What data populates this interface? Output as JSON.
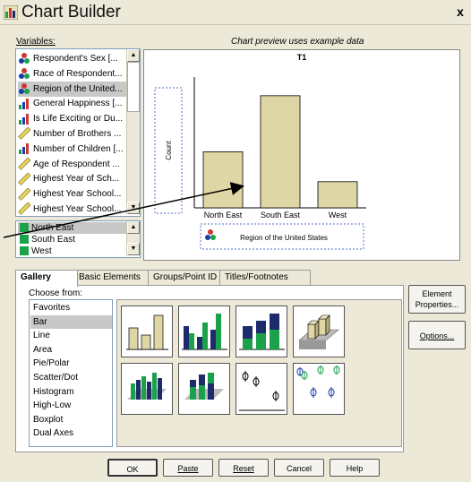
{
  "window": {
    "title": "Chart Builder",
    "close_glyph": "x"
  },
  "variables": {
    "label": "Variables:",
    "items": [
      {
        "label": "Respondent's Sex [...",
        "icon": "nominal-icon"
      },
      {
        "label": "Race of Respondent...",
        "icon": "nominal-icon"
      },
      {
        "label": "Region of the United...",
        "icon": "nominal-icon",
        "selected": true
      },
      {
        "label": "General Happiness [...",
        "icon": "ordinal-icon"
      },
      {
        "label": "Is Life Exciting or Du...",
        "icon": "ordinal-icon"
      },
      {
        "label": "Number of Brothers ...",
        "icon": "scale-icon"
      },
      {
        "label": "Number of Children [...",
        "icon": "ordinal-icon"
      },
      {
        "label": "Age of Respondent ...",
        "icon": "scale-icon"
      },
      {
        "label": "Highest Year of Sch...",
        "icon": "scale-icon"
      },
      {
        "label": "Highest Year School...",
        "icon": "scale-icon"
      },
      {
        "label": "Highest Year School...",
        "icon": "scale-icon"
      },
      {
        "label": "Highest Year School...",
        "icon": "scale-icon"
      }
    ]
  },
  "categories_list": {
    "items": [
      "North East",
      "South East",
      "West"
    ]
  },
  "preview": {
    "note": "Chart preview uses example data",
    "chart_data": {
      "type": "bar",
      "title": "T1",
      "categories": [
        "North East",
        "South East",
        "West"
      ],
      "values": [
        3,
        6,
        1.4
      ],
      "ylabel": "Count",
      "xlabel": "Region of the United States",
      "ylim": [
        0,
        7
      ],
      "bar_color": "#dfd6a6"
    }
  },
  "tabs": [
    "Gallery",
    "Basic Elements",
    "Groups/Point ID",
    "Titles/Footnotes"
  ],
  "gallery": {
    "choose_label": "Choose from:",
    "types": [
      "Favorites",
      "Bar",
      "Line",
      "Area",
      "Pie/Polar",
      "Scatter/Dot",
      "Histogram",
      "High-Low",
      "Boxplot",
      "Dual Axes"
    ],
    "selected_type": "Bar"
  },
  "side_buttons": {
    "element_properties_line1": "Element",
    "element_properties_line2": "Properties...",
    "options": "Options..."
  },
  "footer_buttons": {
    "ok": "OK",
    "paste": "Paste",
    "reset": "Reset",
    "cancel": "Cancel",
    "help": "Help"
  },
  "colors": {
    "bar_tan": "#dfd6a6",
    "bar_green": "#1aa14a",
    "bar_navy": "#1d2a6b",
    "window_bg": "#ece9d8"
  }
}
